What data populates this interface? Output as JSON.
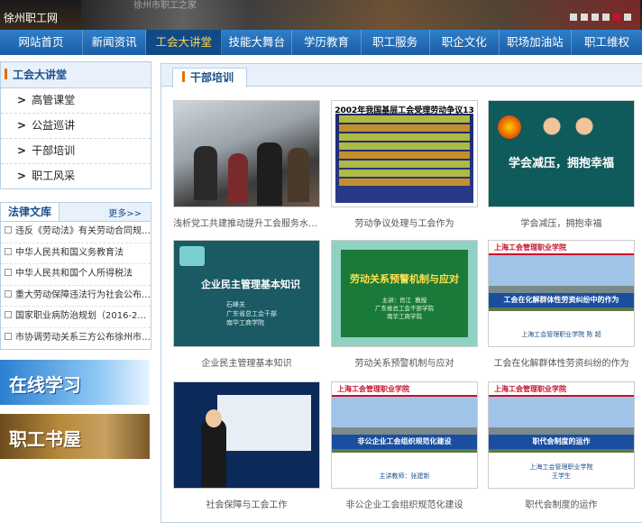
{
  "header": {
    "site_name": "徐州职工网",
    "banner_caption": "徐州市职工之家",
    "slider_dots": 6
  },
  "nav": [
    {
      "label": "网站首页",
      "active": false
    },
    {
      "label": "新闻资讯",
      "active": false
    },
    {
      "label": "工会大讲堂",
      "active": true
    },
    {
      "label": "技能大舞台",
      "active": false
    },
    {
      "label": "学历教育",
      "active": false
    },
    {
      "label": "职工服务",
      "active": false
    },
    {
      "label": "职企文化",
      "active": false
    },
    {
      "label": "职场加油站",
      "active": false
    },
    {
      "label": "职工维权",
      "active": false
    }
  ],
  "sidebar": {
    "title": "工会大讲堂",
    "items": [
      {
        "label": "高管课堂"
      },
      {
        "label": "公益巡讲"
      },
      {
        "label": "干部培训"
      },
      {
        "label": "职工风采"
      }
    ]
  },
  "law": {
    "title": "法律文库",
    "more": "更多>>",
    "items": [
      "违反《劳动法》有关劳动合同规定...",
      "中华人民共和国义务教育法",
      "中华人民共和国个人所得税法",
      "重大劳动保障违法行为社会公布办...",
      "国家职业病防治规划（2016-2020...",
      "市协调劳动关系三方公布徐州市2..."
    ]
  },
  "promos": {
    "online": "在线学习",
    "books": "职工书屋"
  },
  "main": {
    "tab": "干部培训",
    "cards": [
      {
        "caption": "浅析党工共建推动提升工会服务水平...",
        "thumb": "photo"
      },
      {
        "caption": "劳动争议处理与工会作为",
        "thumb": "table",
        "thumb_title": "2002年我国基层工会受理劳动争议13万多件"
      },
      {
        "caption": "学会减压，拥抱幸福",
        "thumb": "teal",
        "thumb_text": "学会减压，拥抱幸福"
      },
      {
        "caption": "企业民主管理基本知识",
        "thumb": "dark",
        "thumb_text": "企业民主管理基本知识",
        "thumb_sub": "石峰关\n广东省总工会干部\n南华工商学院"
      },
      {
        "caption": "劳动关系预警机制与应对",
        "thumb": "board",
        "thumb_text": "劳动关系预警机制与应对",
        "thumb_sub": "主讲：肖江  教授\n广东省总工会干部学院\n南华工商学院"
      },
      {
        "caption": "工会在化解群体性劳资纠纷的作为",
        "thumb": "slide",
        "thumb_text": "工会在化解群体性劳资纠纷中的作为",
        "thumb_sub": "上海工会管理职业学院  陈   超"
      },
      {
        "caption": "社会保障与工会工作",
        "thumb": "video"
      },
      {
        "caption": "非公企业工会组织规范化建设",
        "thumb": "slide",
        "thumb_text": "非公企业工会组织规范化建设",
        "thumb_sub": "主讲教师：张建新"
      },
      {
        "caption": "职代会制度的运作",
        "thumb": "slide",
        "thumb_text": "职代会制度的运作",
        "thumb_sub": "上海工会管理职业学院\n王学生"
      }
    ]
  },
  "colors": {
    "nav": "#1a5ea6",
    "active_nav_text": "#ffd34d",
    "accent_bar": "#e07000",
    "border": "#b7cfe6"
  }
}
